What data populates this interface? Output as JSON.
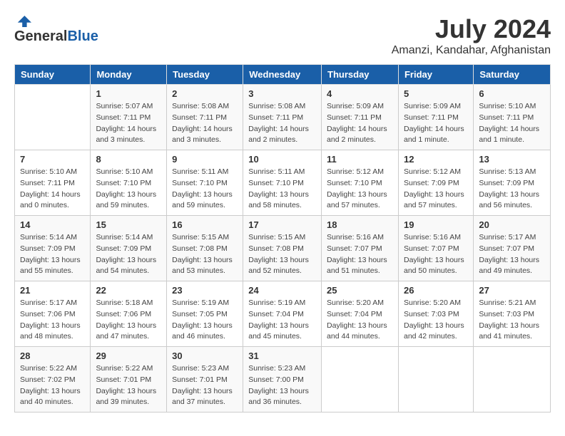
{
  "logo": {
    "general": "General",
    "blue": "Blue"
  },
  "title": {
    "month_year": "July 2024",
    "location": "Amanzi, Kandahar, Afghanistan"
  },
  "weekdays": [
    "Sunday",
    "Monday",
    "Tuesday",
    "Wednesday",
    "Thursday",
    "Friday",
    "Saturday"
  ],
  "weeks": [
    [
      {
        "day": "",
        "sunrise": "",
        "sunset": "",
        "daylight": ""
      },
      {
        "day": "1",
        "sunrise": "Sunrise: 5:07 AM",
        "sunset": "Sunset: 7:11 PM",
        "daylight": "Daylight: 14 hours and 3 minutes."
      },
      {
        "day": "2",
        "sunrise": "Sunrise: 5:08 AM",
        "sunset": "Sunset: 7:11 PM",
        "daylight": "Daylight: 14 hours and 3 minutes."
      },
      {
        "day": "3",
        "sunrise": "Sunrise: 5:08 AM",
        "sunset": "Sunset: 7:11 PM",
        "daylight": "Daylight: 14 hours and 2 minutes."
      },
      {
        "day": "4",
        "sunrise": "Sunrise: 5:09 AM",
        "sunset": "Sunset: 7:11 PM",
        "daylight": "Daylight: 14 hours and 2 minutes."
      },
      {
        "day": "5",
        "sunrise": "Sunrise: 5:09 AM",
        "sunset": "Sunset: 7:11 PM",
        "daylight": "Daylight: 14 hours and 1 minute."
      },
      {
        "day": "6",
        "sunrise": "Sunrise: 5:10 AM",
        "sunset": "Sunset: 7:11 PM",
        "daylight": "Daylight: 14 hours and 1 minute."
      }
    ],
    [
      {
        "day": "7",
        "sunrise": "Sunrise: 5:10 AM",
        "sunset": "Sunset: 7:11 PM",
        "daylight": "Daylight: 14 hours and 0 minutes."
      },
      {
        "day": "8",
        "sunrise": "Sunrise: 5:10 AM",
        "sunset": "Sunset: 7:10 PM",
        "daylight": "Daylight: 13 hours and 59 minutes."
      },
      {
        "day": "9",
        "sunrise": "Sunrise: 5:11 AM",
        "sunset": "Sunset: 7:10 PM",
        "daylight": "Daylight: 13 hours and 59 minutes."
      },
      {
        "day": "10",
        "sunrise": "Sunrise: 5:11 AM",
        "sunset": "Sunset: 7:10 PM",
        "daylight": "Daylight: 13 hours and 58 minutes."
      },
      {
        "day": "11",
        "sunrise": "Sunrise: 5:12 AM",
        "sunset": "Sunset: 7:10 PM",
        "daylight": "Daylight: 13 hours and 57 minutes."
      },
      {
        "day": "12",
        "sunrise": "Sunrise: 5:12 AM",
        "sunset": "Sunset: 7:09 PM",
        "daylight": "Daylight: 13 hours and 57 minutes."
      },
      {
        "day": "13",
        "sunrise": "Sunrise: 5:13 AM",
        "sunset": "Sunset: 7:09 PM",
        "daylight": "Daylight: 13 hours and 56 minutes."
      }
    ],
    [
      {
        "day": "14",
        "sunrise": "Sunrise: 5:14 AM",
        "sunset": "Sunset: 7:09 PM",
        "daylight": "Daylight: 13 hours and 55 minutes."
      },
      {
        "day": "15",
        "sunrise": "Sunrise: 5:14 AM",
        "sunset": "Sunset: 7:09 PM",
        "daylight": "Daylight: 13 hours and 54 minutes."
      },
      {
        "day": "16",
        "sunrise": "Sunrise: 5:15 AM",
        "sunset": "Sunset: 7:08 PM",
        "daylight": "Daylight: 13 hours and 53 minutes."
      },
      {
        "day": "17",
        "sunrise": "Sunrise: 5:15 AM",
        "sunset": "Sunset: 7:08 PM",
        "daylight": "Daylight: 13 hours and 52 minutes."
      },
      {
        "day": "18",
        "sunrise": "Sunrise: 5:16 AM",
        "sunset": "Sunset: 7:07 PM",
        "daylight": "Daylight: 13 hours and 51 minutes."
      },
      {
        "day": "19",
        "sunrise": "Sunrise: 5:16 AM",
        "sunset": "Sunset: 7:07 PM",
        "daylight": "Daylight: 13 hours and 50 minutes."
      },
      {
        "day": "20",
        "sunrise": "Sunrise: 5:17 AM",
        "sunset": "Sunset: 7:07 PM",
        "daylight": "Daylight: 13 hours and 49 minutes."
      }
    ],
    [
      {
        "day": "21",
        "sunrise": "Sunrise: 5:17 AM",
        "sunset": "Sunset: 7:06 PM",
        "daylight": "Daylight: 13 hours and 48 minutes."
      },
      {
        "day": "22",
        "sunrise": "Sunrise: 5:18 AM",
        "sunset": "Sunset: 7:06 PM",
        "daylight": "Daylight: 13 hours and 47 minutes."
      },
      {
        "day": "23",
        "sunrise": "Sunrise: 5:19 AM",
        "sunset": "Sunset: 7:05 PM",
        "daylight": "Daylight: 13 hours and 46 minutes."
      },
      {
        "day": "24",
        "sunrise": "Sunrise: 5:19 AM",
        "sunset": "Sunset: 7:04 PM",
        "daylight": "Daylight: 13 hours and 45 minutes."
      },
      {
        "day": "25",
        "sunrise": "Sunrise: 5:20 AM",
        "sunset": "Sunset: 7:04 PM",
        "daylight": "Daylight: 13 hours and 44 minutes."
      },
      {
        "day": "26",
        "sunrise": "Sunrise: 5:20 AM",
        "sunset": "Sunset: 7:03 PM",
        "daylight": "Daylight: 13 hours and 42 minutes."
      },
      {
        "day": "27",
        "sunrise": "Sunrise: 5:21 AM",
        "sunset": "Sunset: 7:03 PM",
        "daylight": "Daylight: 13 hours and 41 minutes."
      }
    ],
    [
      {
        "day": "28",
        "sunrise": "Sunrise: 5:22 AM",
        "sunset": "Sunset: 7:02 PM",
        "daylight": "Daylight: 13 hours and 40 minutes."
      },
      {
        "day": "29",
        "sunrise": "Sunrise: 5:22 AM",
        "sunset": "Sunset: 7:01 PM",
        "daylight": "Daylight: 13 hours and 39 minutes."
      },
      {
        "day": "30",
        "sunrise": "Sunrise: 5:23 AM",
        "sunset": "Sunset: 7:01 PM",
        "daylight": "Daylight: 13 hours and 37 minutes."
      },
      {
        "day": "31",
        "sunrise": "Sunrise: 5:23 AM",
        "sunset": "Sunset: 7:00 PM",
        "daylight": "Daylight: 13 hours and 36 minutes."
      },
      {
        "day": "",
        "sunrise": "",
        "sunset": "",
        "daylight": ""
      },
      {
        "day": "",
        "sunrise": "",
        "sunset": "",
        "daylight": ""
      },
      {
        "day": "",
        "sunrise": "",
        "sunset": "",
        "daylight": ""
      }
    ]
  ]
}
